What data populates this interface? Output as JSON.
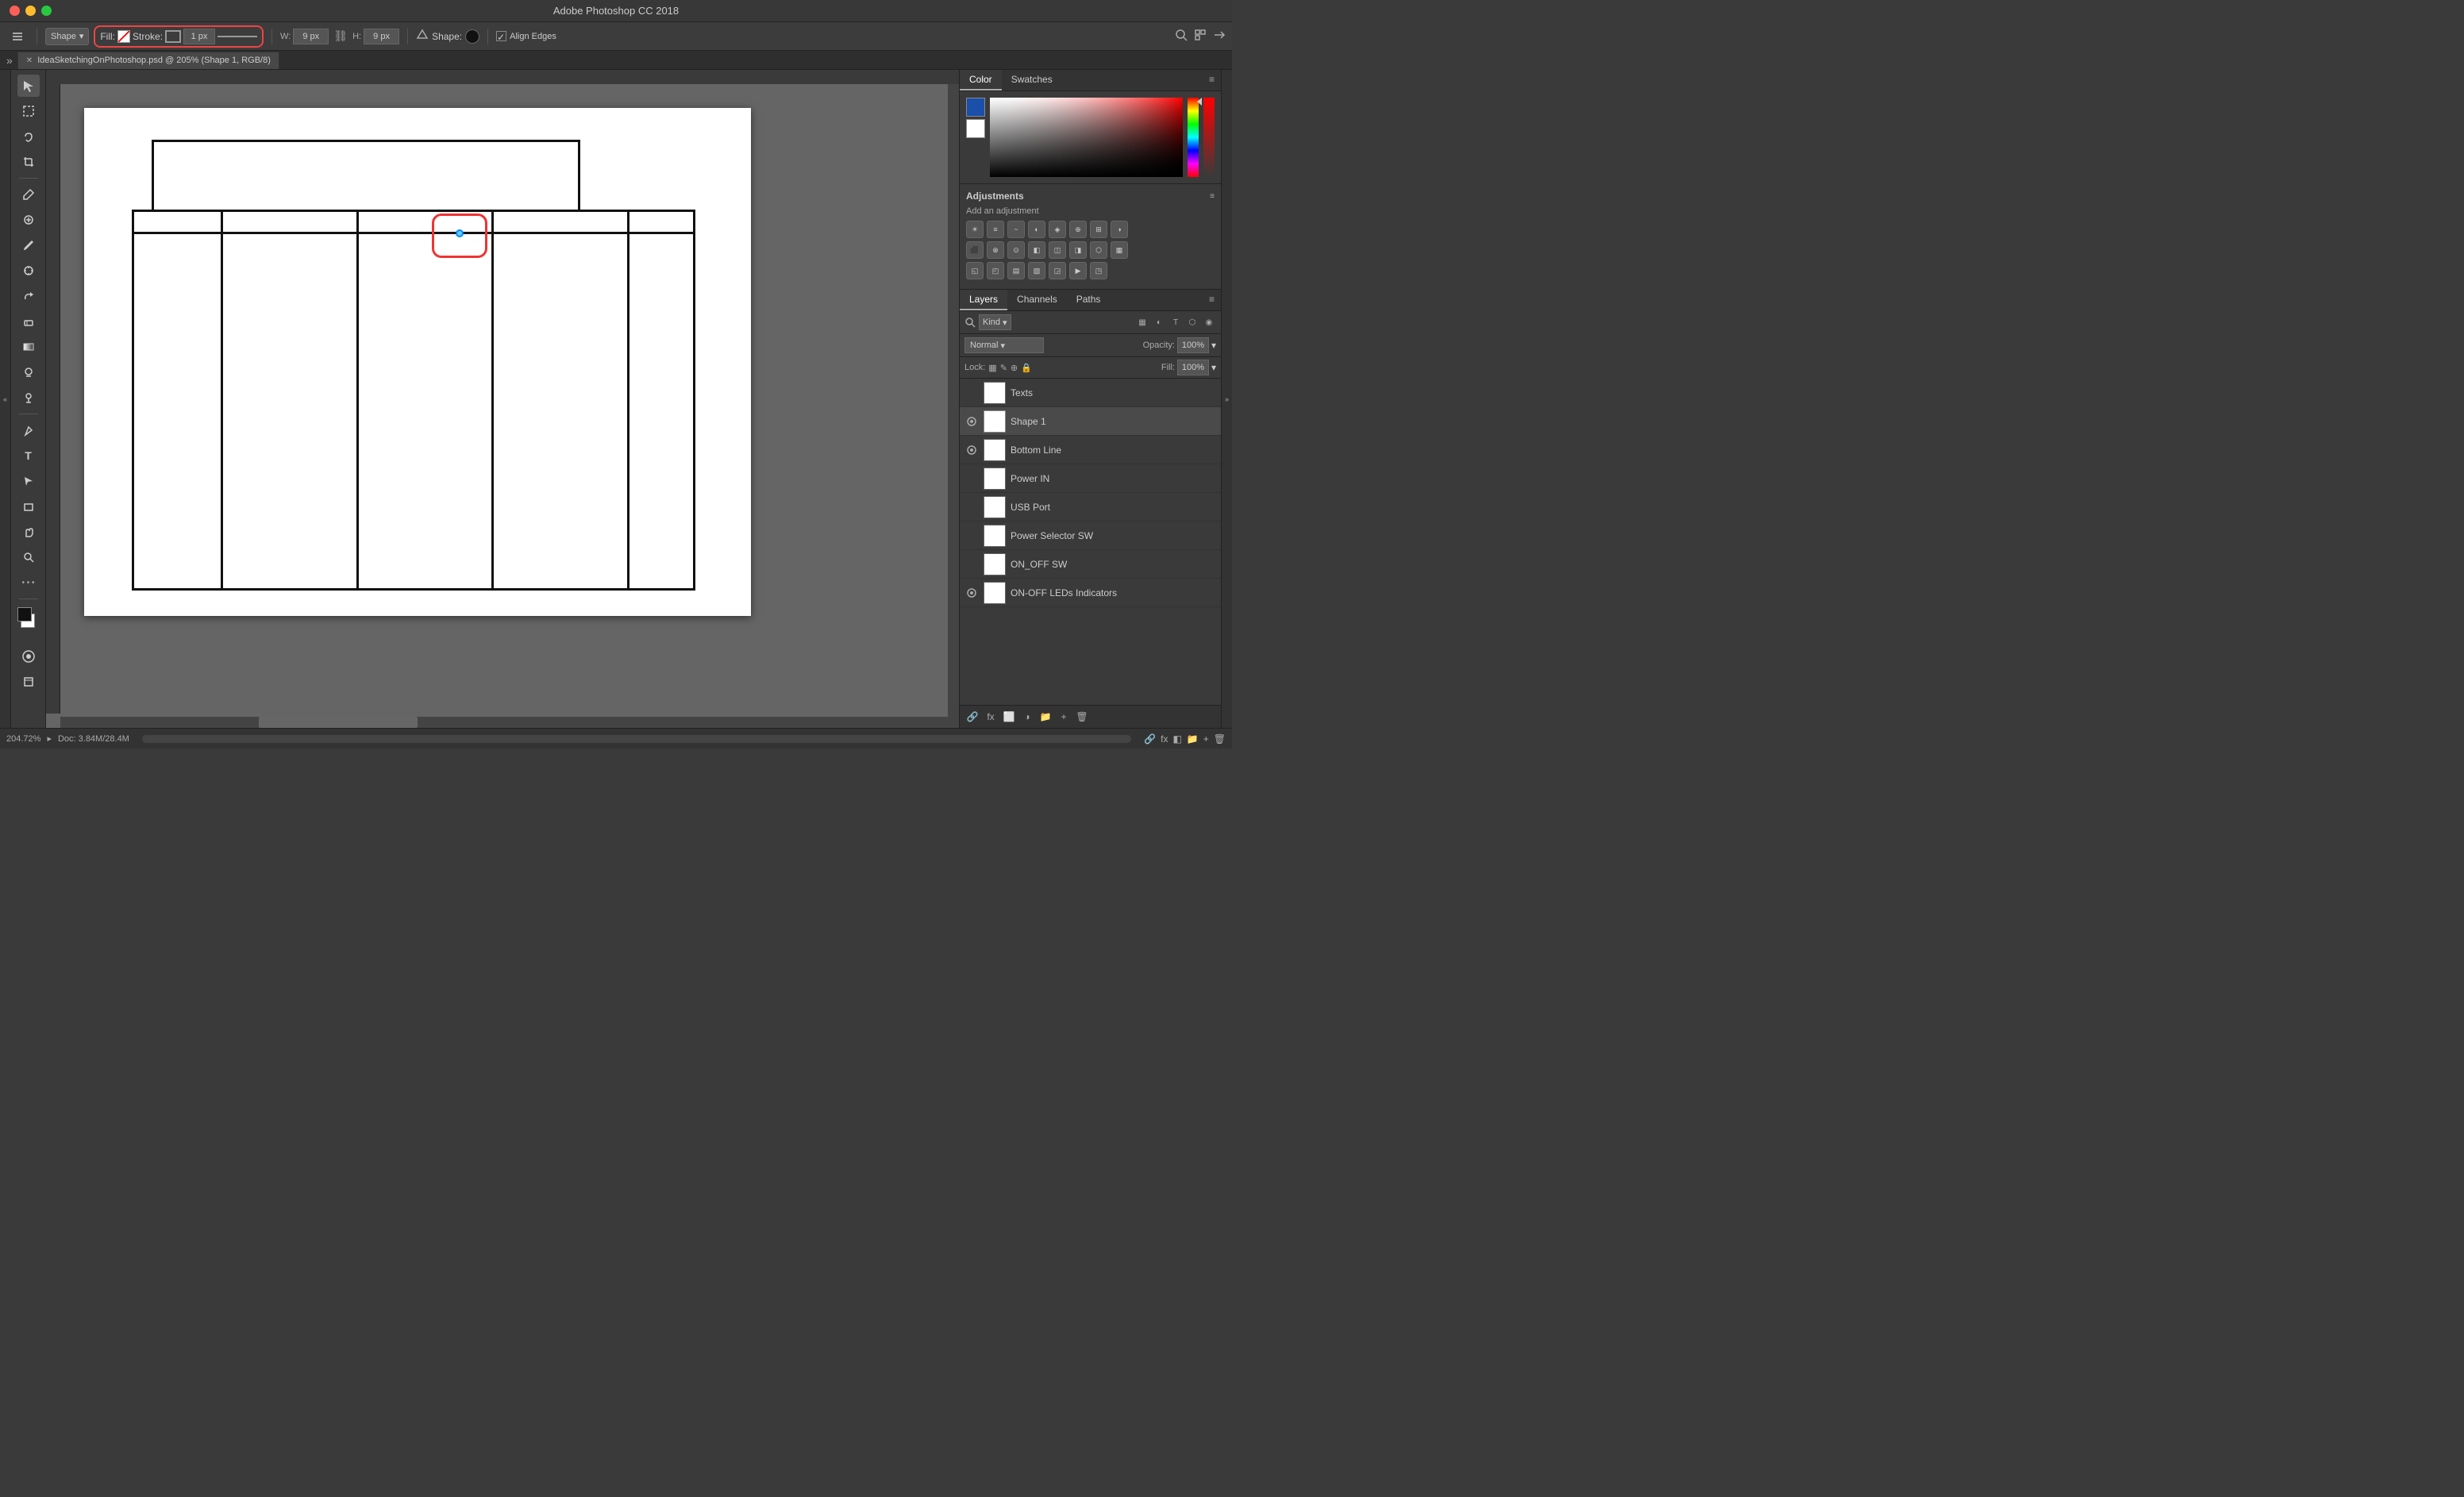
{
  "titleBar": {
    "title": "Adobe Photoshop CC 2018",
    "controls": {
      "close": "●",
      "minimize": "●",
      "maximize": "●"
    }
  },
  "toolbar": {
    "shape_label": "Shape",
    "fill_label": "Fill:",
    "stroke_label": "Stroke:",
    "stroke_size": "1 px",
    "w_label": "W:",
    "w_value": "9 px",
    "h_label": "H:",
    "h_value": "9 px",
    "shape_option": "Shape:",
    "align_edges": "Align Edges"
  },
  "tabBar": {
    "tab_title": "IdeaSketchingOnPhotoshop.psd @ 205% (Shape 1, RGB/8)"
  },
  "canvas": {
    "zoom": "204.72%",
    "doc_info": "Doc: 3.84M/28.4M"
  },
  "rightPanel": {
    "colorTab": "Color",
    "swatchesTab": "Swatches",
    "adjustmentsTitle": "Adjustments",
    "adjustmentsSubtitle": "Add an adjustment",
    "layersTab": "Layers",
    "channelsTab": "Channels",
    "pathsTab": "Paths",
    "kindLabel": "Kind",
    "blendMode": "Normal",
    "opacity_label": "Opacity:",
    "opacity_value": "100%",
    "lock_label": "Lock:",
    "fill_label": "Fill:",
    "fill_value": "100%"
  },
  "layers": [
    {
      "name": "Texts",
      "visible": true,
      "active": false
    },
    {
      "name": "Shape 1",
      "visible": true,
      "active": true
    },
    {
      "name": "Bottom Line",
      "visible": true,
      "active": false
    },
    {
      "name": "Power IN",
      "visible": false,
      "active": false
    },
    {
      "name": "USB Port",
      "visible": false,
      "active": false
    },
    {
      "name": "Power Selector SW",
      "visible": false,
      "active": false
    },
    {
      "name": "ON_OFF SW",
      "visible": false,
      "active": false
    },
    {
      "name": "ON-OFF LEDs Indicators",
      "visible": true,
      "active": false
    }
  ]
}
